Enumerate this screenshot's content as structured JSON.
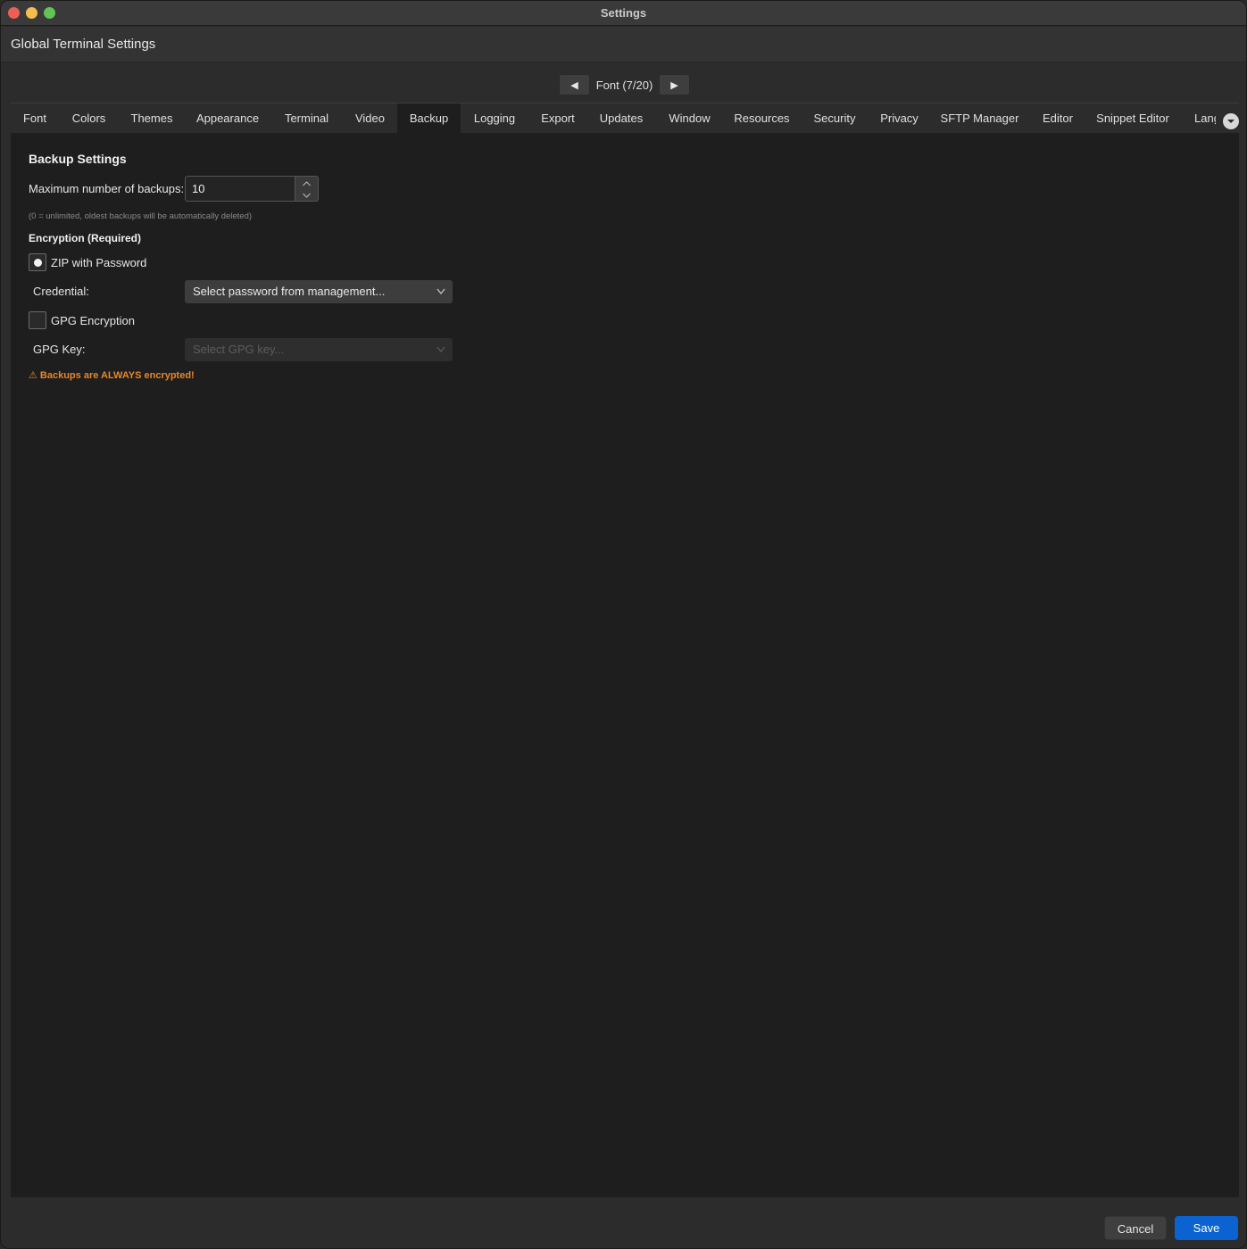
{
  "window": {
    "title": "Settings"
  },
  "header": {
    "title": "Global Terminal Settings"
  },
  "pager": {
    "prev_label": "◀",
    "label": "Font (7/20)",
    "next_label": "▶"
  },
  "tabs": [
    {
      "label": "Font"
    },
    {
      "label": "Colors"
    },
    {
      "label": "Themes"
    },
    {
      "label": "Appearance"
    },
    {
      "label": "Terminal"
    },
    {
      "label": "Video"
    },
    {
      "label": "Backup",
      "active": true
    },
    {
      "label": "Logging"
    },
    {
      "label": "Export"
    },
    {
      "label": "Updates"
    },
    {
      "label": "Window"
    },
    {
      "label": "Resources"
    },
    {
      "label": "Security"
    },
    {
      "label": "Privacy"
    },
    {
      "label": "SFTP Manager"
    },
    {
      "label": "Editor"
    },
    {
      "label": "Snippet Editor"
    },
    {
      "label": "Lang"
    }
  ],
  "backup": {
    "section_title": "Backup Settings",
    "max_backups_label": "Maximum number of backups:",
    "max_backups_value": "10",
    "hint": "(0 = unlimited, oldest backups will be automatically deleted)",
    "encryption_title": "Encryption (Required)",
    "zip_option": {
      "label": "ZIP with Password",
      "selected": true
    },
    "credential_label": "Credential:",
    "credential_select": "Select password from management...",
    "gpg_option": {
      "label": "GPG Encryption",
      "checked": false
    },
    "gpg_key_label": "GPG Key:",
    "gpg_key_select": "Select GPG key...",
    "warning": "⚠ Backups are ALWAYS encrypted!"
  },
  "footer": {
    "cancel_label": "Cancel",
    "save_label": "Save"
  },
  "colors": {
    "accent": "#0a63d0",
    "warning": "#e8862a",
    "content_bg": "#1e1e1e"
  }
}
